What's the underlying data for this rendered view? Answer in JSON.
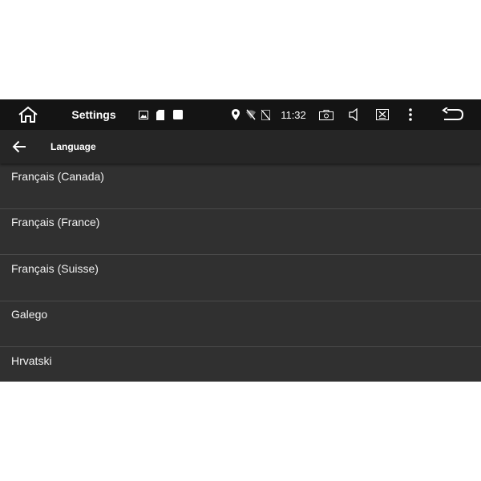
{
  "statusbar": {
    "title": "Settings",
    "time": "11:32",
    "icons": [
      "home-icon",
      "image-notification-icon",
      "sd-card-icon",
      "square-notification-icon",
      "location-icon",
      "wifi-off-icon",
      "no-sim-icon",
      "camera-icon",
      "volume-icon",
      "close-window-icon",
      "more-vert-icon",
      "back-icon"
    ]
  },
  "appbar": {
    "title": "Language"
  },
  "languages": [
    {
      "label": "Français (Canada)"
    },
    {
      "label": "Français (France)"
    },
    {
      "label": "Français (Suisse)"
    },
    {
      "label": "Galego"
    },
    {
      "label": "Hrvatski"
    }
  ],
  "colors": {
    "statusbar_bg": "#141414",
    "appbar_bg": "#262626",
    "list_bg": "#303030",
    "divider": "#4a4a4a",
    "text": "#f2f2f2"
  }
}
